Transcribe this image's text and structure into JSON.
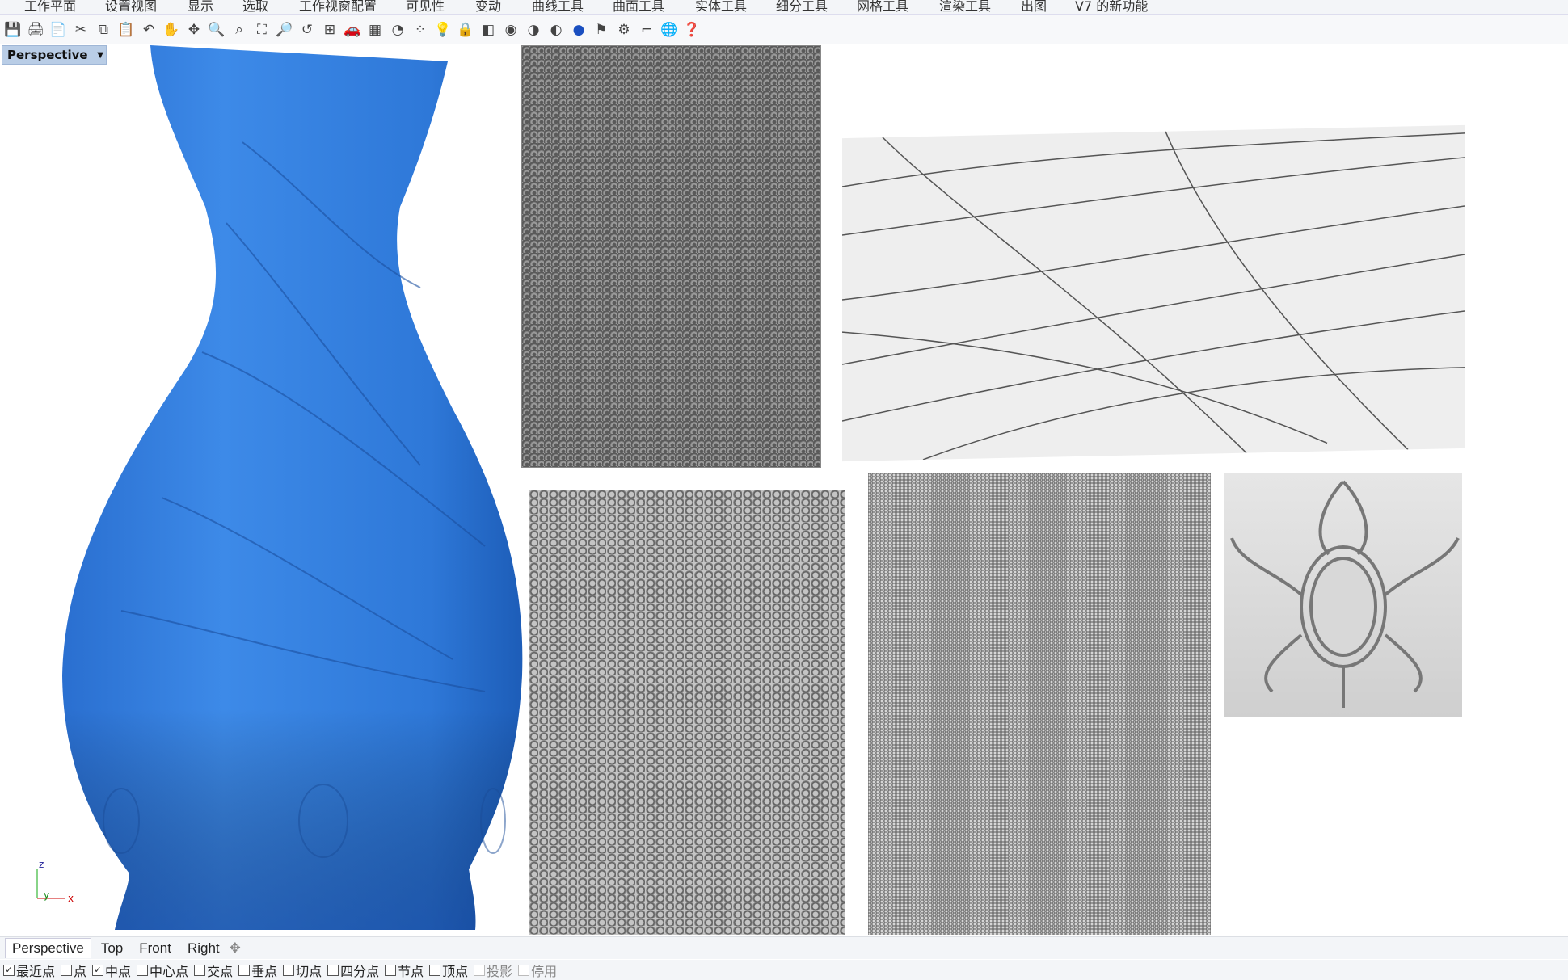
{
  "menu": [
    "工作平面",
    "设置视图",
    "显示",
    "选取",
    "工作视窗配置",
    "可见性",
    "变动",
    "曲线工具",
    "曲面工具",
    "实体工具",
    "细分工具",
    "网格工具",
    "渲染工具",
    "出图",
    "V7 的新功能"
  ],
  "toolbar_icons": [
    "save-icon",
    "print-icon",
    "new-icon",
    "cut-icon",
    "copy-icon",
    "paste-icon",
    "undo-icon",
    "pan-icon",
    "rotate-view-icon",
    "zoom-icon",
    "zoom-window-icon",
    "zoom-extents-icon",
    "zoom-selected-icon",
    "undo-view-icon",
    "viewport-layout-icon",
    "car-icon",
    "grid-icon",
    "circle-icon",
    "points-icon",
    "light-icon",
    "lock-icon",
    "layer-icon",
    "color-wheel-icon",
    "shade-icon",
    "rendered-icon",
    "sphere-icon",
    "flag-icon",
    "gear-icon",
    "dimension-icon",
    "globe-icon",
    "help-icon"
  ],
  "viewport": {
    "label": "Perspective",
    "axis": {
      "z": "z",
      "y": "y",
      "x": "x"
    },
    "vase_color": "#2f7bd9"
  },
  "tabs": [
    "Perspective",
    "Top",
    "Front",
    "Right"
  ],
  "osnap": [
    {
      "label": "最近点",
      "checked": true
    },
    {
      "label": "点",
      "checked": false
    },
    {
      "label": "中点",
      "checked": true
    },
    {
      "label": "中心点",
      "checked": false
    },
    {
      "label": "交点",
      "checked": false
    },
    {
      "label": "垂点",
      "checked": false
    },
    {
      "label": "切点",
      "checked": false
    },
    {
      "label": "四分点",
      "checked": false
    },
    {
      "label": "节点",
      "checked": false
    },
    {
      "label": "顶点",
      "checked": false
    },
    {
      "label": "投影",
      "checked": false,
      "disabled": true
    },
    {
      "label": "停用",
      "checked": false,
      "disabled": true
    }
  ]
}
